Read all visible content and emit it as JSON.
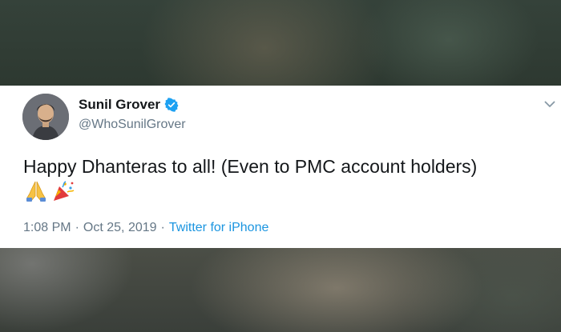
{
  "tweet": {
    "author": {
      "name": "Sunil Grover",
      "handle": "@WhoSunilGrover",
      "verified": true
    },
    "text": "Happy Dhanteras to all! (Even to PMC account holders)",
    "emojis": [
      "folded-hands-emoji",
      "party-popper-emoji"
    ],
    "time": "1:08 PM",
    "date": "Oct 25, 2019",
    "separator": "·",
    "source": "Twitter for iPhone"
  },
  "colors": {
    "verified_badge": "#1da1f2",
    "source_link": "#1b95e0",
    "secondary_text": "#657786",
    "primary_text": "#14171a"
  }
}
